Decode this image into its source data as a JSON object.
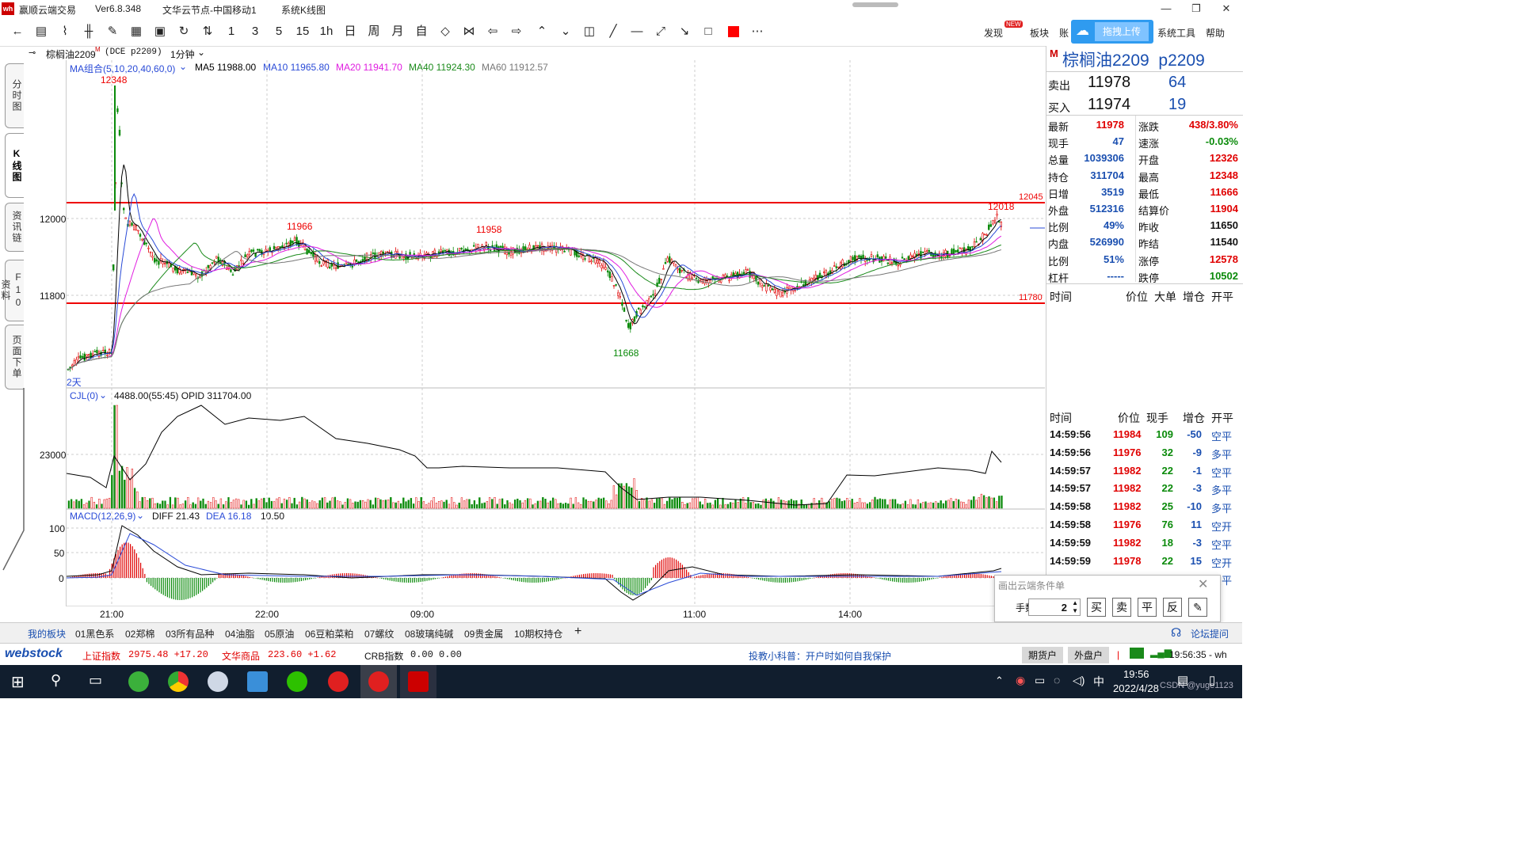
{
  "window": {
    "app_name": "赢顺云端交易",
    "version": "Ver6.8.348",
    "server": "文华云节点-中国移动1",
    "view_title": "系统K线图",
    "logo_text": "wh"
  },
  "toolbar": {
    "periods": [
      "1",
      "3",
      "5",
      "15",
      "1h",
      "日",
      "周",
      "月",
      "自"
    ],
    "right_items": [
      "发现",
      "板块",
      "账",
      "拖拽上传",
      "系统工具",
      "帮助"
    ],
    "new_badge": "NEW"
  },
  "chart_header": {
    "symbol": "棕榈油2209",
    "symbol_sup": "M",
    "exchange_code": "(DCE p2209)",
    "interval": "1分钟",
    "ma_group": "MA组合(5,10,20,40,60,0)",
    "ma5": "MA5 11988.00",
    "ma10": "MA10 11965.80",
    "ma20": "MA20 11941.70",
    "ma40": "MA40 11924.30",
    "ma60": "MA60 11912.57",
    "ma_colors": {
      "ma5": "#000000",
      "ma10": "#2a4bd7",
      "ma20": "#e01ce0",
      "ma40": "#1a8a1a",
      "ma60": "#777777"
    },
    "days_label": "2天"
  },
  "left_tabs": [
    "分时图",
    "K线图",
    "资讯链",
    "F10资料",
    "页面下单"
  ],
  "price_panel": {
    "yticks": [
      "12000",
      "11800"
    ],
    "lines": {
      "upper": "12045",
      "lower": "11780"
    },
    "annotations": [
      "12348",
      "11966",
      "11958",
      "11668",
      "12018"
    ]
  },
  "volume_panel": {
    "header": "CJL(0)",
    "values": "4488.00(55:45)  OPID 311704.00",
    "ytick": "23000"
  },
  "macd_panel": {
    "header": "MACD(12,26,9)",
    "diff": "DIFF 21.43",
    "dea": "DEA 16.18",
    "macd": "10.50",
    "yticks": [
      "100",
      "50",
      "0"
    ]
  },
  "x_axis": [
    "21:00",
    "22:00",
    "09:00",
    "11:00",
    "14:00"
  ],
  "quote": {
    "title": "棕榈油2209  p2209",
    "title_flag": "M",
    "sell_label": "卖出",
    "sell_price": "11978",
    "sell_vol": "64",
    "buy_label": "买入",
    "buy_price": "11974",
    "buy_vol": "19",
    "rows": [
      {
        "l1": "最新",
        "v1": "11978",
        "c1": "#e00000",
        "l2": "涨跌",
        "v2": "438/3.80%",
        "c2": "#e00000"
      },
      {
        "l1": "现手",
        "v1": "47",
        "c1": "#1a4fb0",
        "l2": "速涨",
        "v2": "-0.03%",
        "c2": "#0a8a0a"
      },
      {
        "l1": "总量",
        "v1": "1039306",
        "c1": "#1a4fb0",
        "l2": "开盘",
        "v2": "12326",
        "c2": "#e00000"
      },
      {
        "l1": "持仓",
        "v1": "311704",
        "c1": "#1a4fb0",
        "l2": "最高",
        "v2": "12348",
        "c2": "#e00000"
      },
      {
        "l1": "日增",
        "v1": "3519",
        "c1": "#1a4fb0",
        "l2": "最低",
        "v2": "11666",
        "c2": "#e00000"
      },
      {
        "l1": "外盘",
        "v1": "512316",
        "c1": "#1a4fb0",
        "l2": "结算价",
        "v2": "11904",
        "c2": "#e00000"
      },
      {
        "l1": "比例",
        "v1": "49%",
        "c1": "#1a4fb0",
        "l2": "昨收",
        "v2": "11650",
        "c2": "#111111"
      },
      {
        "l1": "内盘",
        "v1": "526990",
        "c1": "#1a4fb0",
        "l2": "昨结",
        "v2": "11540",
        "c2": "#111111"
      },
      {
        "l1": "比例",
        "v1": "51%",
        "c1": "#1a4fb0",
        "l2": "涨停",
        "v2": "12578",
        "c2": "#e00000"
      },
      {
        "l1": "杠杆",
        "v1": "-----",
        "c1": "#1a4fb0",
        "l2": "跌停",
        "v2": "10502",
        "c2": "#0a8a0a"
      }
    ],
    "ticks_header": [
      "时间",
      "价位",
      "大单",
      "增仓",
      "开平"
    ],
    "ticks_header2": [
      "时间",
      "价位",
      "现手",
      "增仓",
      "开平"
    ],
    "ticks": [
      {
        "time": "14:59:56",
        "price": "11984",
        "vol": "109",
        "oi": "-50",
        "type": "空平",
        "tc": "#1a4fb0"
      },
      {
        "time": "14:59:56",
        "price": "11976",
        "vol": "32",
        "oi": "-9",
        "type": "多平",
        "tc": "#1a4fb0"
      },
      {
        "time": "14:59:57",
        "price": "11982",
        "vol": "22",
        "oi": "-1",
        "type": "空平",
        "tc": "#1a4fb0"
      },
      {
        "time": "14:59:57",
        "price": "11982",
        "vol": "22",
        "oi": "-3",
        "type": "多平",
        "tc": "#1a4fb0"
      },
      {
        "time": "14:59:58",
        "price": "11982",
        "vol": "25",
        "oi": "-10",
        "type": "多平",
        "tc": "#1a4fb0"
      },
      {
        "time": "14:59:58",
        "price": "11976",
        "vol": "76",
        "oi": "11",
        "type": "空开",
        "tc": "#1a4fb0"
      },
      {
        "time": "14:59:59",
        "price": "11982",
        "vol": "18",
        "oi": "-3",
        "type": "空平",
        "tc": "#1a4fb0"
      },
      {
        "time": "14:59:59",
        "price": "11978",
        "vol": "22",
        "oi": "15",
        "type": "空开",
        "tc": "#1a4fb0"
      }
    ],
    "partial_last": "空平"
  },
  "popup": {
    "title": "画出云端条件单",
    "qty_label": "手数",
    "qty_value": "2",
    "buttons": [
      "买",
      "卖",
      "平",
      "反"
    ]
  },
  "sectors": [
    "我的板块",
    "01黑色系",
    "02郑棉",
    "03所有品种",
    "04油脂",
    "05原油",
    "06豆粕菜粕",
    "07螺纹",
    "08玻璃纯碱",
    "09贵金属",
    "10期权持仓",
    "+"
  ],
  "forum": "论坛提问",
  "statusbar": {
    "brand": "webstock",
    "idx1": "上证指数",
    "idx1_val": "2975.48 +17.20",
    "idx2": "文华商品",
    "idx2_val": "223.60 +1.62",
    "idx3": "CRB指数",
    "idx3_val": "0.00 0.00",
    "tip": "投教小科普：开户时如何自我保护",
    "btn1": "期货户",
    "btn2": "外盘户",
    "time": "19:56:35 - wh"
  },
  "taskbar": {
    "clock": "19:56",
    "date": "2022/4/28",
    "ime": "中",
    "watermark": "CSDN @yuge1123"
  }
}
